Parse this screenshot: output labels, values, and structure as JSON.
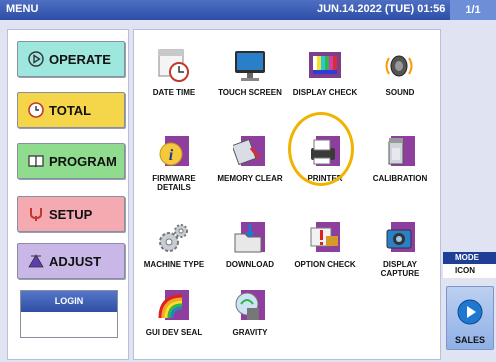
{
  "header": {
    "title": "MENU",
    "datetime": "JUN.14.2022 (TUE) 01:56",
    "page": "1/1"
  },
  "nav": [
    {
      "label": "OPERATE",
      "icon": "play-icon",
      "color": "#9ee7df"
    },
    {
      "label": "TOTAL",
      "icon": "clock-icon",
      "color": "#f5d64a"
    },
    {
      "label": "PROGRAM",
      "icon": "book-icon",
      "color": "#8fdc8f"
    },
    {
      "label": "SETUP",
      "icon": "setup-icon",
      "color": "#f4aab0"
    },
    {
      "label": "ADJUST",
      "icon": "adjust-icon",
      "color": "#c9b7e8"
    }
  ],
  "login": {
    "label": "LOGIN"
  },
  "items": [
    {
      "label": "DATE TIME",
      "icon": "calendar-clock-icon"
    },
    {
      "label": "TOUCH SCREEN",
      "icon": "monitor-icon"
    },
    {
      "label": "DISPLAY CHECK",
      "icon": "color-bars-icon"
    },
    {
      "label": "SOUND",
      "icon": "speaker-icon"
    },
    {
      "label": "FIRMWARE DETAILS",
      "icon": "info-icon"
    },
    {
      "label": "MEMORY CLEAR",
      "icon": "memory-card-icon"
    },
    {
      "label": "PRINTER",
      "icon": "printer-icon"
    },
    {
      "label": "CALIBRATION",
      "icon": "calibration-icon"
    },
    {
      "label": "MACHINE TYPE",
      "icon": "gears-icon"
    },
    {
      "label": "DOWNLOAD",
      "icon": "download-folder-icon"
    },
    {
      "label": "OPTION CHECK",
      "icon": "option-check-icon"
    },
    {
      "label": "DISPLAY CAPTURE",
      "icon": "camera-icon"
    },
    {
      "label": "GUI DEV SEAL",
      "icon": "rainbow-icon"
    },
    {
      "label": "GRAVITY",
      "icon": "gravity-icon"
    }
  ],
  "mode": {
    "title": "MODE",
    "value": "ICON"
  },
  "sales": {
    "label": "SALES"
  },
  "highlight_color": "#f0b400"
}
